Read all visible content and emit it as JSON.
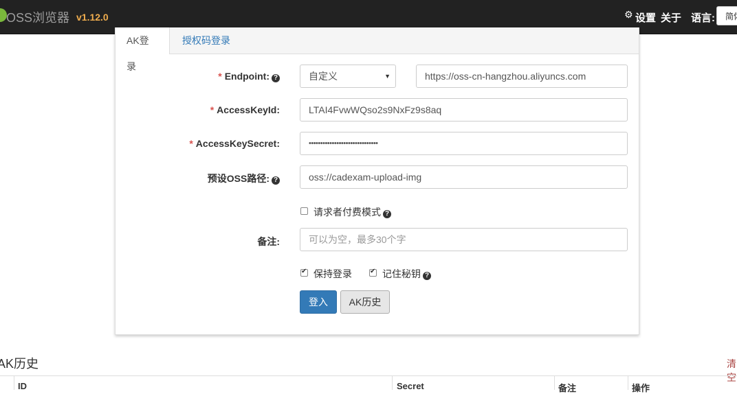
{
  "header": {
    "brand": "OSS浏览器",
    "version": "v1.12.0",
    "settings": "设置",
    "about": "关于",
    "language_label": "语言:",
    "language_value": "简体中文"
  },
  "tabs": {
    "ak_login": "AK登录",
    "auth_login": "授权码登录"
  },
  "form": {
    "endpoint_label": "Endpoint:",
    "endpoint_type": "自定义",
    "endpoint_value": "https://oss-cn-hangzhou.aliyuncs.com",
    "accesskeyid_label": "AccessKeyId:",
    "accesskeyid_value": "LTAI4FvwWQso2s9NxFz9s8aq",
    "accesskeysecret_label": "AccessKeySecret:",
    "accesskeysecret_value": "••••••••••••••••••••••••••••••",
    "preset_path_label": "预设OSS路径:",
    "preset_path_value": "oss://cadexam-upload-img",
    "requester_pays_label": "请求者付费模式",
    "requester_pays_checked": false,
    "note_label": "备注:",
    "note_placeholder": "可以为空，最多30个字",
    "keep_login_label": "保持登录",
    "keep_login_checked": true,
    "remember_key_label": "记住秘钥",
    "remember_key_checked": true,
    "login_button": "登入",
    "ak_history_button": "AK历史"
  },
  "history": {
    "title": "AK历史",
    "clear": "清空",
    "columns": [
      "ID",
      "Secret",
      "备注",
      "操作"
    ]
  },
  "colors": {
    "topbar": "#222222",
    "version": "#f0ad4e",
    "primary": "#337ab7",
    "required": "#d9534f"
  }
}
